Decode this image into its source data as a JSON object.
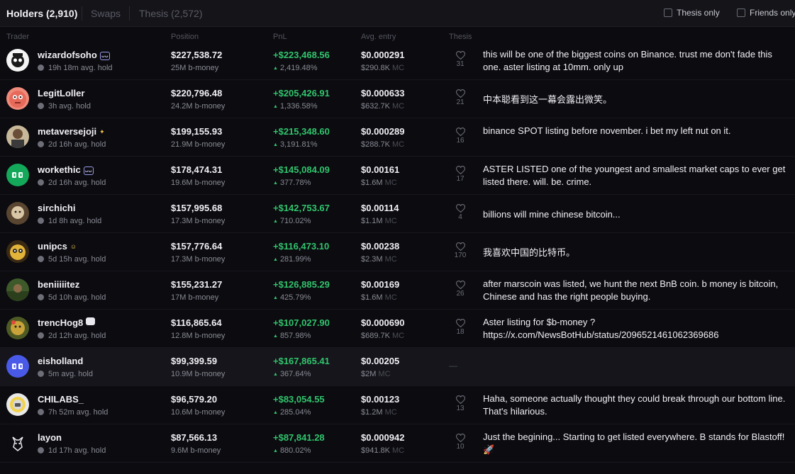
{
  "tabs": [
    {
      "label": "Holders (2,910)",
      "active": true
    },
    {
      "label": "Swaps",
      "active": false
    },
    {
      "label": "Thesis (2,572)",
      "active": false
    }
  ],
  "filters": {
    "thesis_only": "Thesis only",
    "friends_only": "Friends only"
  },
  "columns": {
    "trader": "Trader",
    "position": "Position",
    "pnl": "PnL",
    "avg_entry": "Avg. entry",
    "thesis": "Thesis"
  },
  "mc_label": "MC",
  "colors": {
    "positive": "#31c46c",
    "background": "#0b0b10",
    "header": "#141419"
  },
  "rows": [
    {
      "name": "wizardofsoho",
      "badge": "ᴗᴗ",
      "hold": "19h 18m avg. hold",
      "position": "$227,538.72",
      "amount": "25M b-money",
      "pnl": "+$223,468.56",
      "pnl_pct": "2,419.48%",
      "avg_entry": "$0.000291",
      "mc": "$290.8K",
      "likes": "31",
      "thesis": "this will be one of the biggest coins on Binance. trust me don't fade this one. aster listing at 10mm. only up"
    },
    {
      "name": "LegitLoller",
      "hold": "3h avg. hold",
      "position": "$220,796.48",
      "amount": "24.2M b-money",
      "pnl": "+$205,426.91",
      "pnl_pct": "1,336.58%",
      "avg_entry": "$0.000633",
      "mc": "$632.7K",
      "likes": "21",
      "thesis": "中本聪看到这一幕会露出微笑。"
    },
    {
      "name": "metaversejoji",
      "badge": "✦",
      "hold": "2d 16h avg. hold",
      "position": "$199,155.93",
      "amount": "21.9M b-money",
      "pnl": "+$215,348.60",
      "pnl_pct": "3,191.81%",
      "avg_entry": "$0.000289",
      "mc": "$288.7K",
      "likes": "16",
      "thesis": "binance SPOT listing before november. i bet my left nut on it."
    },
    {
      "name": "workethic",
      "badge": "ᴗᴗ",
      "hold": "2d 16h avg. hold",
      "position": "$178,474.31",
      "amount": "19.6M b-money",
      "pnl": "+$145,084.09",
      "pnl_pct": "377.78%",
      "avg_entry": "$0.00161",
      "mc": "$1.6M",
      "likes": "17",
      "thesis": "ASTER LISTED one of the youngest and smallest market caps to ever get listed there. will. be. crime."
    },
    {
      "name": "sirchichi",
      "hold": "1d 8h avg. hold",
      "position": "$157,995.68",
      "amount": "17.3M b-money",
      "pnl": "+$142,753.67",
      "pnl_pct": "710.02%",
      "avg_entry": "$0.00114",
      "mc": "$1.1M",
      "likes": "4",
      "thesis": "billions will mine chinese bitcoin..."
    },
    {
      "name": "unipcs",
      "badge": "☺",
      "hold": "5d 15h avg. hold",
      "position": "$157,776.64",
      "amount": "17.3M b-money",
      "pnl": "+$116,473.10",
      "pnl_pct": "281.99%",
      "avg_entry": "$0.00238",
      "mc": "$2.3M",
      "likes": "170",
      "thesis": "我喜欢中国的比特币。"
    },
    {
      "name": "beniiiiitez",
      "hold": "5d 10h avg. hold",
      "position": "$155,231.27",
      "amount": "17M b-money",
      "pnl": "+$126,885.29",
      "pnl_pct": "425.79%",
      "avg_entry": "$0.00169",
      "mc": "$1.6M",
      "likes": "26",
      "thesis": "after marscoin was listed, we hunt the next BnB coin. b money is bitcoin, Chinese and has the right people buying."
    },
    {
      "name": "trencHog8",
      "badge": "",
      "hold": "2d 12h avg. hold",
      "position": "$116,865.64",
      "amount": "12.8M b-money",
      "pnl": "+$107,027.90",
      "pnl_pct": "857.98%",
      "avg_entry": "$0.000690",
      "mc": "$689.7K",
      "likes": "18",
      "thesis": "Aster listing for $b-money ? https://x.com/NewsBotHub/status/2096521461062369686"
    },
    {
      "name": "eisholland",
      "hold": "5m avg. hold",
      "position": "$99,399.59",
      "amount": "10.9M b-money",
      "pnl": "+$167,865.41",
      "pnl_pct": "367.64%",
      "avg_entry": "$0.00205",
      "mc": "$2M",
      "likes": "",
      "thesis": "",
      "empty_thesis": "—"
    },
    {
      "name": "CHILABS_",
      "hold": "7h 52m avg. hold",
      "position": "$96,579.20",
      "amount": "10.6M b-money",
      "pnl": "+$83,054.55",
      "pnl_pct": "285.04%",
      "avg_entry": "$0.00123",
      "mc": "$1.2M",
      "likes": "13",
      "thesis": "Haha, someone actually thought they could break through our bottom line. That's hilarious."
    },
    {
      "name": "layon",
      "hold": "1d 17h avg. hold",
      "position": "$87,566.13",
      "amount": "9.6M b-money",
      "pnl": "+$87,841.28",
      "pnl_pct": "880.02%",
      "avg_entry": "$0.000942",
      "mc": "$941.8K",
      "likes": "10",
      "thesis": "Just the begining... Starting to get listed everywhere. B stands for Blastoff! 🚀"
    }
  ]
}
